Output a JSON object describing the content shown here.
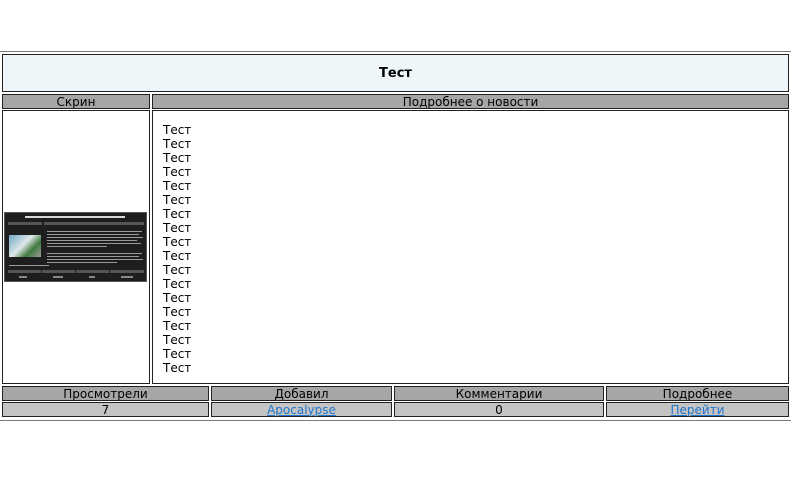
{
  "post": {
    "title": "Тест"
  },
  "columns": {
    "screen_label": "Скрин",
    "details_label": "Подробнее о новости"
  },
  "news_lines": [
    "Тест",
    "Тест",
    "Тест",
    "Тест",
    "Тест",
    "Тест",
    "Тест",
    "Тест",
    "Тест",
    "Тест",
    "Тест",
    "Тест",
    "Тест",
    "Тест",
    "Тест",
    "Тест",
    "Тест",
    "Тест"
  ],
  "thumbnail": {
    "icon": "screenshot-thumbnail"
  },
  "footer": {
    "headers": {
      "views": "Просмотрели",
      "author": "Добавил",
      "comments": "Комментарии",
      "more": "Подробнее"
    },
    "values": {
      "views": "7",
      "author": "Apocalypse",
      "comments": "0",
      "more": "Перейти"
    }
  },
  "colors": {
    "title_bg": "#eef6fa",
    "header_bg": "#a6a6a6",
    "value_bg": "#c4c4c4",
    "link": "#2277cc"
  }
}
